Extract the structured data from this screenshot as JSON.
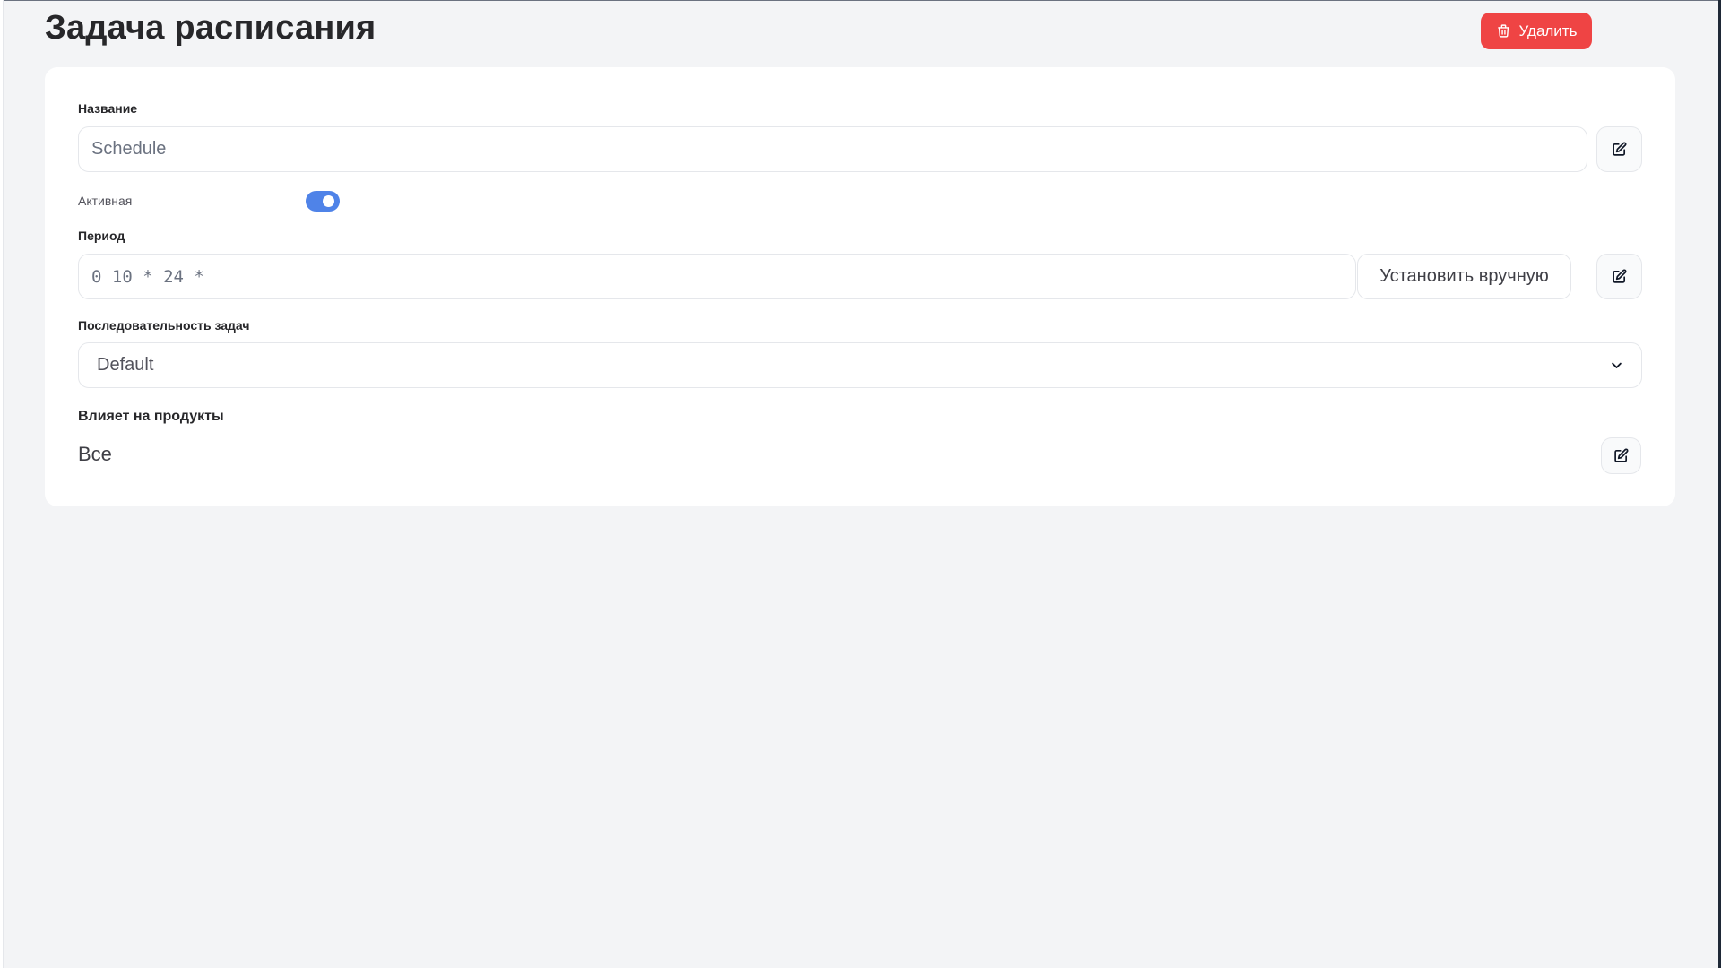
{
  "page": {
    "title": "Задача расписания"
  },
  "header": {
    "delete_label": "Удалить",
    "delete_icon": "trash-icon",
    "delete_color": "#ef4444"
  },
  "form": {
    "name": {
      "label": "Название",
      "value": "Schedule",
      "edit_icon": "edit-icon"
    },
    "active": {
      "label": "Активная",
      "checked": true,
      "accent": "#4f83e8"
    },
    "period": {
      "label": "Период",
      "value": "0 10 * 24 *",
      "manual_button_label": "Установить вручную",
      "edit_icon": "edit-icon"
    },
    "sequence": {
      "label": "Последовательность задач",
      "selected": "Default",
      "chevron_icon": "chevron-down-icon"
    },
    "products": {
      "label": "Влияет на продукты",
      "value": "Все",
      "edit_icon": "edit-icon"
    }
  }
}
